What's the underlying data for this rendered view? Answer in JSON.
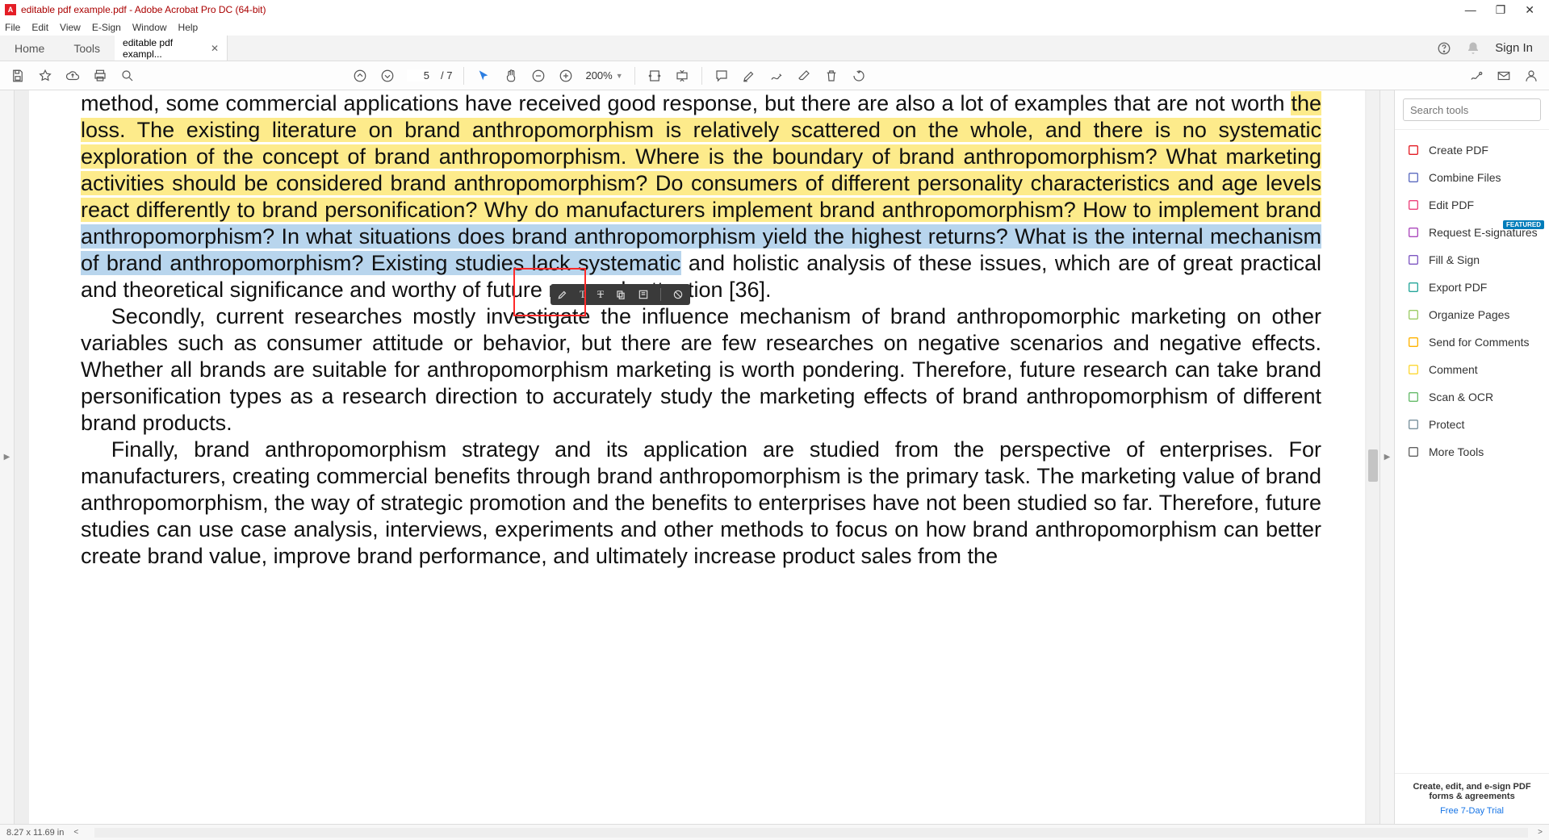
{
  "window": {
    "title": "editable pdf example.pdf - Adobe Acrobat Pro DC (64-bit)",
    "app_icon_letter": "A"
  },
  "menu": {
    "items": [
      "File",
      "Edit",
      "View",
      "E-Sign",
      "Window",
      "Help"
    ]
  },
  "tabs": {
    "home": "Home",
    "tools": "Tools",
    "doc_tab": "editable pdf exampl...",
    "sign_in": "Sign In"
  },
  "toolbar": {
    "page_current": "5",
    "page_total": "/ 7",
    "zoom": "200%"
  },
  "search_placeholder": "Search tools",
  "tool_items": [
    {
      "label": "Create PDF",
      "color": "#e41e26"
    },
    {
      "label": "Combine Files",
      "color": "#5c6bc0"
    },
    {
      "label": "Edit PDF",
      "color": "#ec407a"
    },
    {
      "label": "Request E-signatures",
      "color": "#ab47bc",
      "badge": "FEATURED"
    },
    {
      "label": "Fill & Sign",
      "color": "#7e57c2"
    },
    {
      "label": "Export PDF",
      "color": "#26a69a"
    },
    {
      "label": "Organize Pages",
      "color": "#9ccc65"
    },
    {
      "label": "Send for Comments",
      "color": "#ffb300"
    },
    {
      "label": "Comment",
      "color": "#fdd835"
    },
    {
      "label": "Scan & OCR",
      "color": "#66bb6a"
    },
    {
      "label": "Protect",
      "color": "#78909c"
    },
    {
      "label": "More Tools",
      "color": "#616161"
    }
  ],
  "footer": {
    "l1": "Create, edit, and e-sign PDF",
    "l2": "forms & agreements",
    "trial": "Free 7-Day Trial"
  },
  "status": {
    "dims": "8.27 x 11.69 in"
  },
  "doc": {
    "p1_pre": "method, some commercial applications have received good response, but there are also a lot of examples that are not worth ",
    "p1_hl_yellow": "the loss. The existing literature on brand anthropomorphism is relatively scattered on the whole, and there is no systematic exploration of the concept of brand anthropomorphism. Where is the boundary of brand anthropomorphism? What marketing activities should be considered brand anthropomorphism? Do consumers of different personality characteristics and age levels react differently to brand personification? Why do manufacturers implement brand anthropomorphism? How to implement brand ",
    "p1_hl_blue": "anthropomorphism? In what situations does brand anthropomorphism yield the highest returns? What is the internal mechanism of brand anthropomorphism? Existing studies lack systematic",
    "p1_post": " and holistic analysis of these issues, which are of great practical and theoretical significance and worthy of future research attention [36].",
    "p2": "Secondly, current researches mostly investigate the influence mechanism of brand anthropomorphic marketing on other variables such as consumer attitude or behavior, but there are few researches on negative scenarios and negative effects. Whether all brands are suitable for anthropomorphism marketing is worth pondering. Therefore, future research can take brand personification types as a research direction to accurately study the marketing effects of brand anthropomorphism of different brand products.",
    "p3": "Finally, brand anthropomorphism strategy and its application are studied from the perspective of enterprises. For manufacturers, creating commercial benefits through brand anthropomorphism is the primary task. The marketing value of brand anthropomorphism, the way of strategic promotion and the benefits to enterprises have not been studied so far. Therefore, future studies can use case analysis, interviews, experiments and other methods to focus on how brand anthropomorphism can better create brand value, improve brand performance, and ultimately increase product sales from the"
  }
}
